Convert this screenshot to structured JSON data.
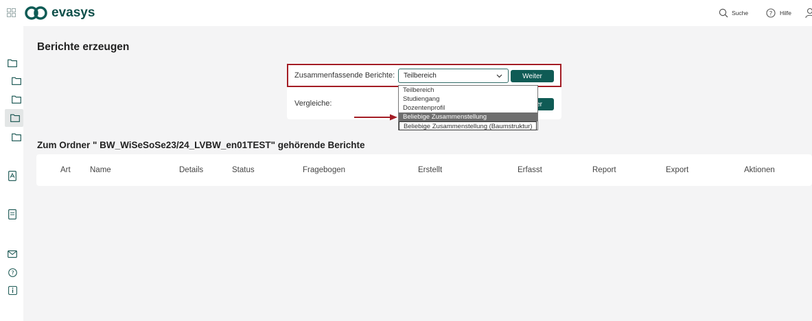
{
  "app": {
    "name": "evasys"
  },
  "header": {
    "search_label": "Suche",
    "help_label": "Hilfe"
  },
  "page": {
    "title": "Berichte erzeugen"
  },
  "reports_form": {
    "summary_label": "Zusammenfassende Berichte:",
    "summary_selected": "Teilbereich",
    "summary_button": "Weiter",
    "compare_label": "Vergleiche:",
    "compare_button_partial": "er",
    "dropdown_options": [
      "Teilbereich",
      "Studiengang",
      "Dozentenprofil",
      "Beliebige Zusammenstellung",
      "Beliebige Zusammenstellung (Baumstruktur)"
    ],
    "dropdown_highlighted_index": 3
  },
  "folder_section": {
    "heading": "Zum Ordner \" BW_WiSeSoSe23/24_LVBW_en01TEST\" gehörende Berichte",
    "columns": [
      "Art",
      "Name",
      "Details",
      "Status",
      "Fragebogen",
      "Erstellt",
      "Erfasst",
      "Report",
      "Export",
      "Aktionen"
    ]
  },
  "colors": {
    "accent": "#0f5b55",
    "highlight_box": "#a31c24",
    "arrow": "#a31c24"
  },
  "icons": [
    "apps-grid-icon",
    "evasys-logo-icon",
    "search-icon",
    "help-icon",
    "user-icon",
    "folder-icon",
    "pdf-icon",
    "document-icon",
    "mail-icon",
    "info-icon"
  ]
}
